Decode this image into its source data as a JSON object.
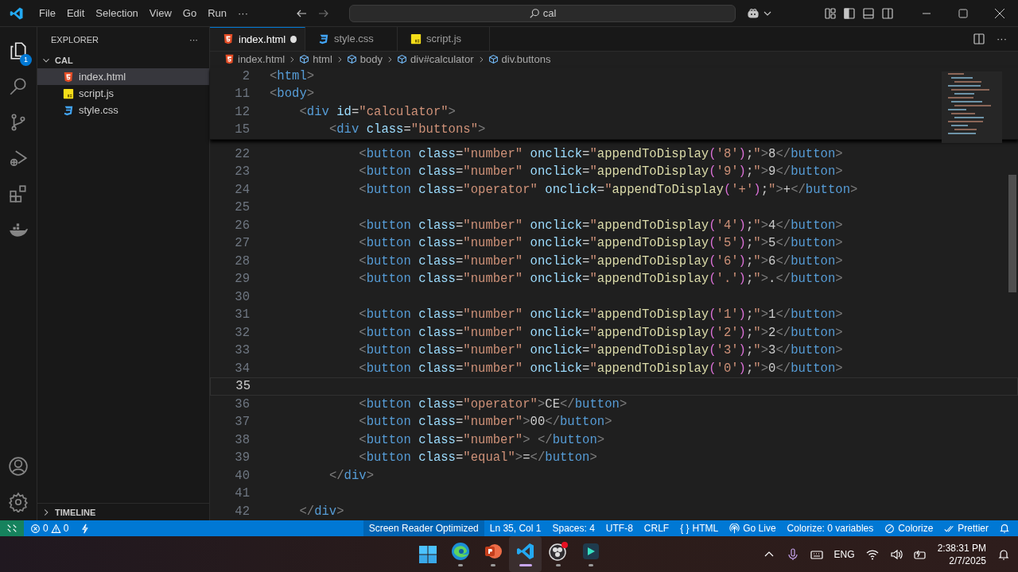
{
  "menu": [
    "File",
    "Edit",
    "Selection",
    "View",
    "Go",
    "Run",
    "···"
  ],
  "search": {
    "value": "cal"
  },
  "activity_bar": {
    "badge": "1"
  },
  "explorer": {
    "title": "EXPLORER",
    "more": "···",
    "folder": {
      "label": "CAL",
      "expanded": true,
      "files": [
        {
          "label": "index.html",
          "kind": "html",
          "selected": true
        },
        {
          "label": "script.js",
          "kind": "js",
          "selected": false
        },
        {
          "label": "style.css",
          "kind": "css",
          "selected": false
        }
      ]
    },
    "timeline": {
      "label": "TIMELINE",
      "expanded": false
    }
  },
  "tabs": [
    {
      "label": "index.html",
      "kind": "html",
      "selected": true,
      "modified": true
    },
    {
      "label": "style.css",
      "kind": "css",
      "selected": false,
      "modified": false
    },
    {
      "label": "script.js",
      "kind": "js",
      "selected": false,
      "modified": false
    }
  ],
  "tab_actions": {
    "more": "···"
  },
  "breadcrumb": [
    {
      "label": "index.html",
      "kind": "file"
    },
    {
      "label": "html",
      "kind": "element"
    },
    {
      "label": "body",
      "kind": "element"
    },
    {
      "label": "div#calculator",
      "kind": "element"
    },
    {
      "label": "div.buttons",
      "kind": "element"
    }
  ],
  "sticky_lines": [
    {
      "number": "2",
      "text": "<html>"
    },
    {
      "number": "11",
      "text": "<body>"
    },
    {
      "number": "12",
      "text": "    <div id=\"calculator\">"
    },
    {
      "number": "15",
      "text": "        <div class=\"buttons\">"
    }
  ],
  "lines": [
    {
      "number": "22",
      "current": false,
      "text": "            <button class=\"number\" onclick=\"appendToDisplay('8');\">8</button>"
    },
    {
      "number": "23",
      "current": false,
      "text": "            <button class=\"number\" onclick=\"appendToDisplay('9');\">9</button>"
    },
    {
      "number": "24",
      "current": false,
      "text": "            <button class=\"operator\" onclick=\"appendToDisplay('+');\">+</button>"
    },
    {
      "number": "25",
      "current": false
    },
    {
      "number": "26",
      "current": false,
      "text": "            <button class=\"number\" onclick=\"appendToDisplay('4');\">4</button>"
    },
    {
      "number": "27",
      "current": false,
      "text": "            <button class=\"number\" onclick=\"appendToDisplay('5');\">5</button>"
    },
    {
      "number": "28",
      "current": false,
      "text": "            <button class=\"number\" onclick=\"appendToDisplay('6');\">6</button>"
    },
    {
      "number": "29",
      "current": false,
      "text": "            <button class=\"number\" onclick=\"appendToDisplay('.');\">.</button>"
    },
    {
      "number": "30",
      "current": false
    },
    {
      "number": "31",
      "current": false,
      "text": "            <button class=\"number\" onclick=\"appendToDisplay('1');\">1</button>"
    },
    {
      "number": "32",
      "current": false,
      "text": "            <button class=\"number\" onclick=\"appendToDisplay('2');\">2</button>"
    },
    {
      "number": "33",
      "current": false,
      "text": "            <button class=\"number\" onclick=\"appendToDisplay('3');\">3</button>"
    },
    {
      "number": "34",
      "current": false,
      "text": "            <button class=\"number\" onclick=\"appendToDisplay('0');\">0</button>"
    },
    {
      "number": "35",
      "current": true
    },
    {
      "number": "36",
      "current": false,
      "text": "            <button class=\"operator\">CE</button>"
    },
    {
      "number": "37",
      "current": false,
      "text": "            <button class=\"number\">00</button>"
    },
    {
      "number": "38",
      "current": false,
      "text": "            <button class=\"number\"> </button>"
    },
    {
      "number": "39",
      "current": false,
      "text": "            <button class=\"equal\">=</button>"
    },
    {
      "number": "40",
      "current": false,
      "text": "        </div>"
    },
    {
      "number": "41",
      "current": false
    },
    {
      "number": "42",
      "current": false,
      "text": "    </div>"
    }
  ],
  "status_bar": {
    "errors": "0",
    "warnings": "0",
    "items": [
      {
        "label": "Screen Reader Optimized",
        "kind": "plain"
      },
      {
        "label": "Ln 35, Col 1",
        "kind": "plain"
      },
      {
        "label": "Spaces: 4",
        "kind": "plain"
      },
      {
        "label": "UTF-8",
        "kind": "plain"
      },
      {
        "label": "CRLF",
        "kind": "plain"
      },
      {
        "label": "HTML",
        "kind": "language",
        "icon_text": "{ }"
      },
      {
        "label": "Go Live",
        "kind": "broadcast"
      },
      {
        "label": "Colorize: 0 variables",
        "kind": "plain"
      },
      {
        "label": "Colorize",
        "kind": "blocked"
      },
      {
        "label": "Prettier",
        "kind": "checks"
      }
    ]
  },
  "taskbar": {
    "apps": [
      {
        "kind": "start",
        "selected": false
      },
      {
        "kind": "edge",
        "selected": false
      },
      {
        "kind": "powerpoint",
        "selected": false
      },
      {
        "kind": "vscode",
        "selected": true
      },
      {
        "kind": "recorder",
        "selected": false
      },
      {
        "kind": "editor",
        "selected": false
      }
    ],
    "language": "ENG",
    "time": "2:38:31 PM",
    "date": "2/7/2025"
  }
}
